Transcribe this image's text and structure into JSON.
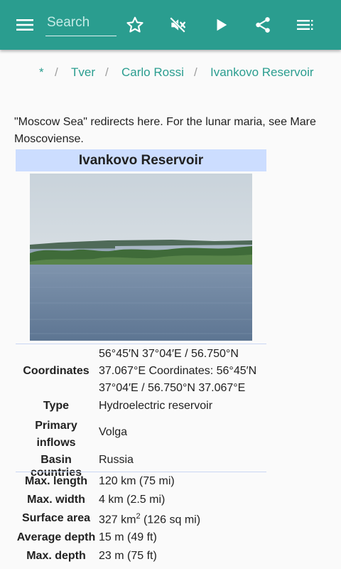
{
  "toolbar": {
    "menu_icon": "hamburger-menu-icon",
    "search_placeholder": "Search",
    "actions": [
      "star-icon",
      "mute-icon",
      "play-icon",
      "share-icon",
      "list-icon"
    ]
  },
  "breadcrumb": [
    "*",
    "Tver",
    "Carlo Rossi",
    "Ivankovo Reservoir"
  ],
  "intro_text": "\"Moscow Sea\" redirects here. For the lunar maria, see Mare Moscoviense.",
  "infobox": {
    "title": "Ivankovo Reservoir",
    "rows": [
      {
        "label": "Coordinates",
        "value": "56°45′N 37°04′E / 56.750°N 37.067°E Coordinates: 56°45′N 37°04′E / 56.750°N 37.067°E"
      },
      {
        "label": "Type",
        "value": "Hydroelectric reservoir"
      },
      {
        "label": "Primary inflows",
        "value": "Volga"
      },
      {
        "label": "Basin countries",
        "value": "Russia"
      },
      {
        "label": "Max. length",
        "value": "120 km (75 mi)"
      },
      {
        "label": "Max. width",
        "value": "4 km (2.5 mi)"
      },
      {
        "label": "Surface area",
        "value_pre": "327 km",
        "value_sup": "2",
        "value_post": " (126 sq mi)"
      },
      {
        "label": "Average depth",
        "value": "15 m (49 ft)"
      },
      {
        "label": "Max. depth",
        "value": "23 m (75 ft)"
      }
    ]
  },
  "colors": {
    "primary": "#2a9d8f",
    "infobox_header": "#ccddff"
  }
}
